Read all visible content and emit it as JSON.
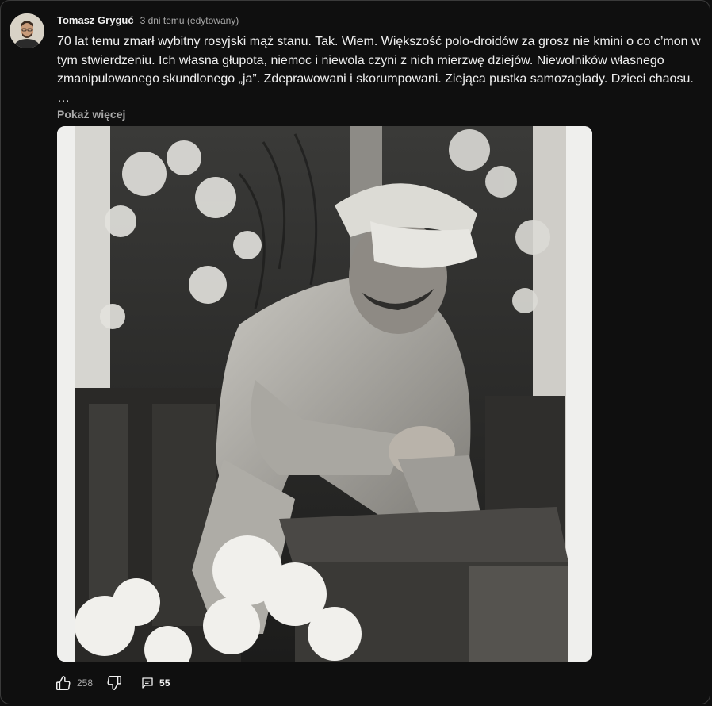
{
  "post": {
    "author": "Tomasz Gryguć",
    "time": "3 dni temu (edytowany)",
    "text": "70 lat temu zmarł wybitny rosyjski mąż stanu. Tak. Wiem. Większość polo-droidów za grosz nie kmini o co c’mon w tym stwierdzeniu. Ich własna głupota, niemoc i niewola czyni z nich mierzwę dziejów. Niewolników własnego zmanipulowanego skundlonego „ja”. Zdeprawowani i skorumpowani. Ziejąca pustka samozagłady. Dzieci chaosu. …",
    "show_more": "Pokaż więcej",
    "image_icon": "black-and-white-photo"
  },
  "actions": {
    "like_count": "258",
    "comment_count": "55",
    "like_icon": "thumbs-up-icon",
    "dislike_icon": "thumbs-down-icon",
    "comment_icon": "comment-icon"
  }
}
